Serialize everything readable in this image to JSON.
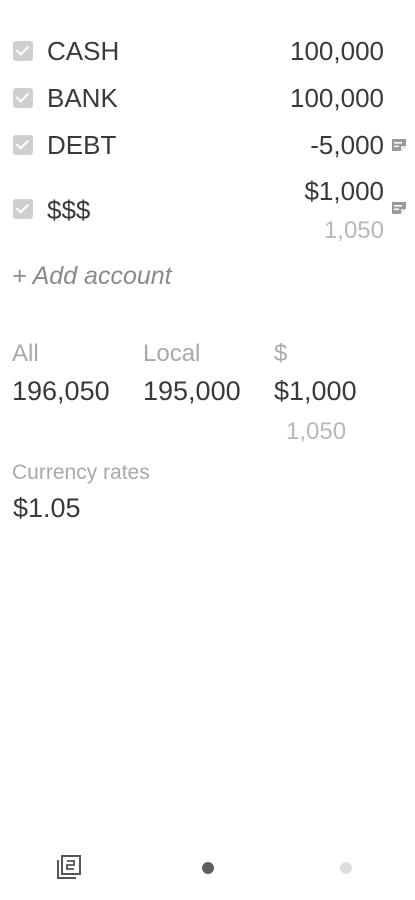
{
  "accounts": [
    {
      "name": "CASH",
      "amount": "100,000",
      "checked": true,
      "has_note": false
    },
    {
      "name": "BANK",
      "amount": "100,000",
      "checked": true,
      "has_note": false
    },
    {
      "name": "DEBT",
      "amount": "-5,000",
      "checked": true,
      "has_note": true
    },
    {
      "name": "$$$",
      "amount": "$1,000",
      "converted": "1,050",
      "checked": true,
      "has_note": true
    }
  ],
  "add_account_label": "+ Add account",
  "totals": {
    "all": {
      "label": "All",
      "value": "196,050"
    },
    "local": {
      "label": "Local",
      "value": "195,000"
    },
    "foreign": {
      "label": "$",
      "value": "$1,000",
      "converted": "1,050"
    }
  },
  "currency_rates": {
    "label": "Currency rates",
    "value": "$1.05"
  },
  "bottom_bar": {
    "pages_icon": "pages-icon",
    "page_count": 2,
    "active_page": 1
  },
  "colors": {
    "text": "#3a3a3a",
    "muted": "#a9a9a9",
    "checkbox": "#cfcfcf",
    "dot_active": "#5f5f5f",
    "dot_inactive": "#dcdcdc"
  }
}
